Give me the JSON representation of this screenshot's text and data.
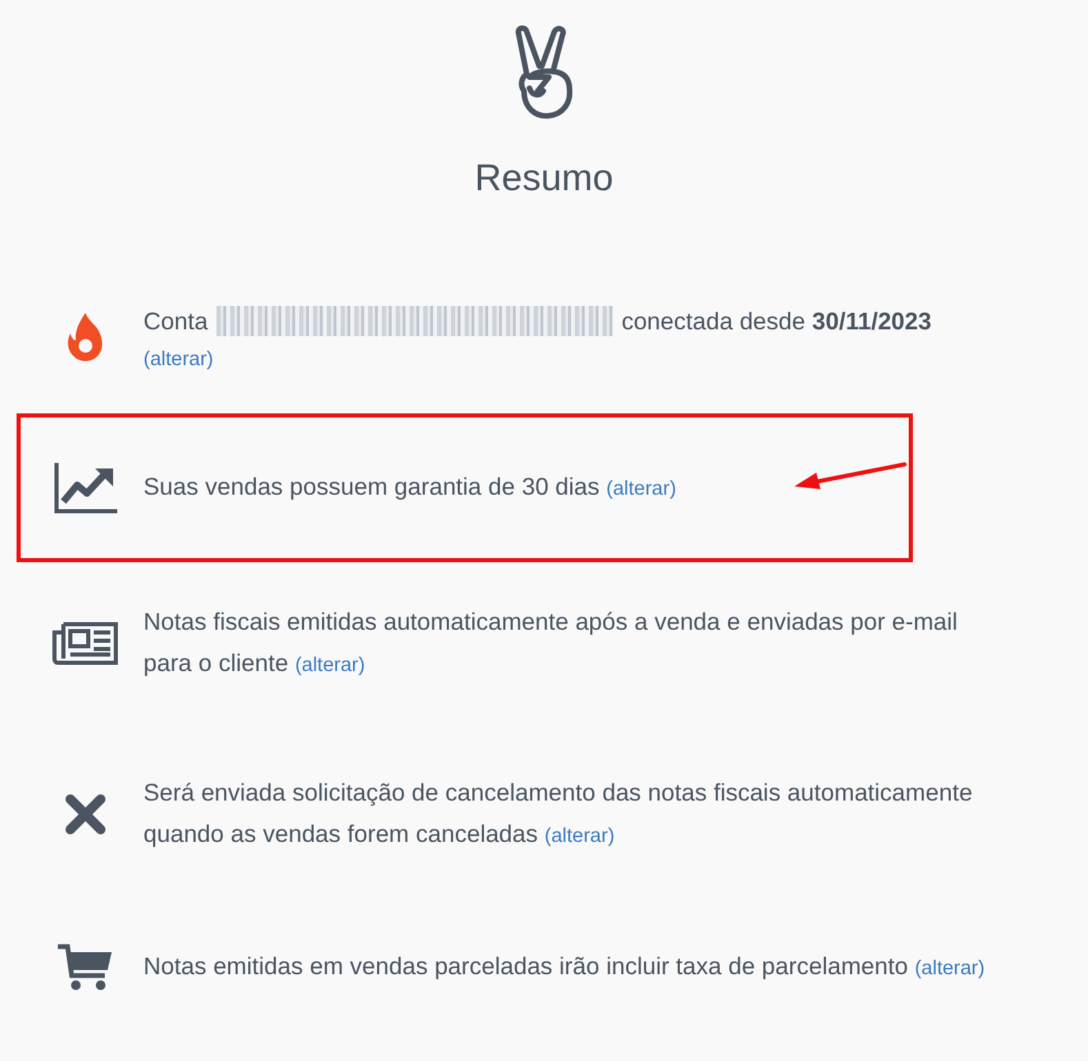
{
  "header": {
    "title": "Resumo"
  },
  "items": [
    {
      "kind": "flame",
      "text": "Conta",
      "redacted": true,
      "text_after": "conectada desde **30/11/2023**",
      "link": "(alterar)",
      "link_on_new_line": true
    },
    {
      "kind": "chart",
      "text": "Suas vendas possuem garantia de 30 dias",
      "link": "(alterar)",
      "highlighted": true
    },
    {
      "kind": "newspaper",
      "text": "Notas fiscais emitidas automaticamente após a venda e enviadas por e-mail para o cliente",
      "link": "(alterar)"
    },
    {
      "kind": "cross",
      "text": "Será enviada solicitação de cancelamento das notas fiscais automaticamente quando as vendas forem canceladas",
      "link": "(alterar)"
    },
    {
      "kind": "cart",
      "text": "Notas emitidas em vendas parceladas irão incluir taxa de parcelamento",
      "link": "(alterar)"
    }
  ]
}
